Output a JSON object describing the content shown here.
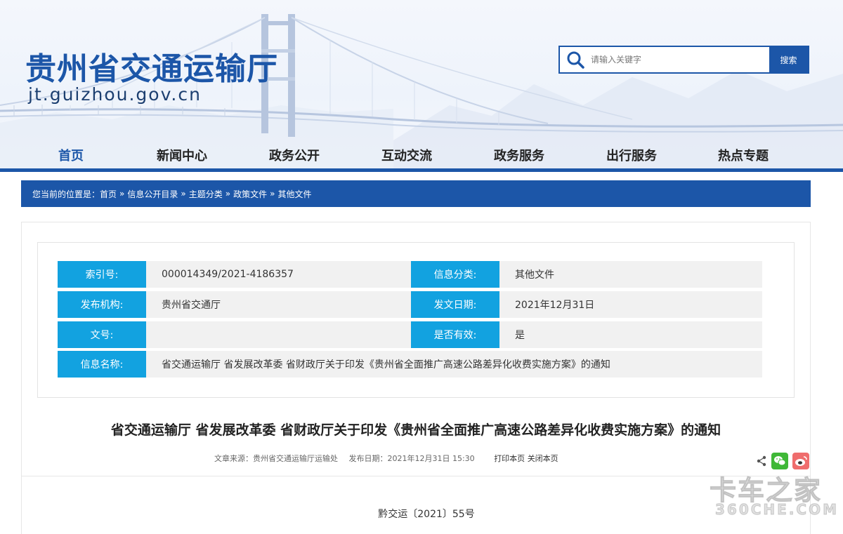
{
  "header": {
    "site_title": "贵州省交通运输厅",
    "site_domain": "jt.guizhou.gov.cn",
    "search": {
      "placeholder": "请输入关键字",
      "button_label": "搜索"
    }
  },
  "nav": {
    "items": [
      {
        "label": "首页",
        "active": true
      },
      {
        "label": "新闻中心"
      },
      {
        "label": "政务公开"
      },
      {
        "label": "互动交流"
      },
      {
        "label": "政务服务"
      },
      {
        "label": "出行服务"
      },
      {
        "label": "热点专题"
      }
    ]
  },
  "breadcrumb": {
    "prefix": "您当前的位置是：",
    "separator": "»",
    "items": [
      "首页",
      "信息公开目录",
      "主题分类",
      "政策文件",
      "其他文件"
    ]
  },
  "info": {
    "rows": [
      {
        "label1": "索引号:",
        "value1": "000014349/2021-4186357",
        "label2": "信息分类:",
        "value2": "其他文件"
      },
      {
        "label1": "发布机构:",
        "value1": "贵州省交通厅",
        "label2": "发文日期:",
        "value2": "2021年12月31日"
      },
      {
        "label1": "文号:",
        "value1": "",
        "label2": "是否有效:",
        "value2": "是"
      }
    ],
    "name_label": "信息名称:",
    "name_value": "省交通运输厅 省发展改革委 省财政厅关于印发《贵州省全面推广高速公路差异化收费实施方案》的通知"
  },
  "article": {
    "title": "省交通运输厅 省发展改革委 省财政厅关于印发《贵州省全面推广高速公路差异化收费实施方案》的通知",
    "source": "文章来源：贵州省交通运输厅运输处",
    "published": "发布日期：2021年12月31日 15:30",
    "print_label": "打印本页",
    "close_label": "关闭本页",
    "doc_number": "黔交运〔2021〕55号"
  },
  "watermark": {
    "main": "卡车之家",
    "sub": "360CHE.COM"
  },
  "colors": {
    "primary": "#1c56a8",
    "label_bg": "#12a2e0",
    "value_bg": "#f1f1f1"
  }
}
